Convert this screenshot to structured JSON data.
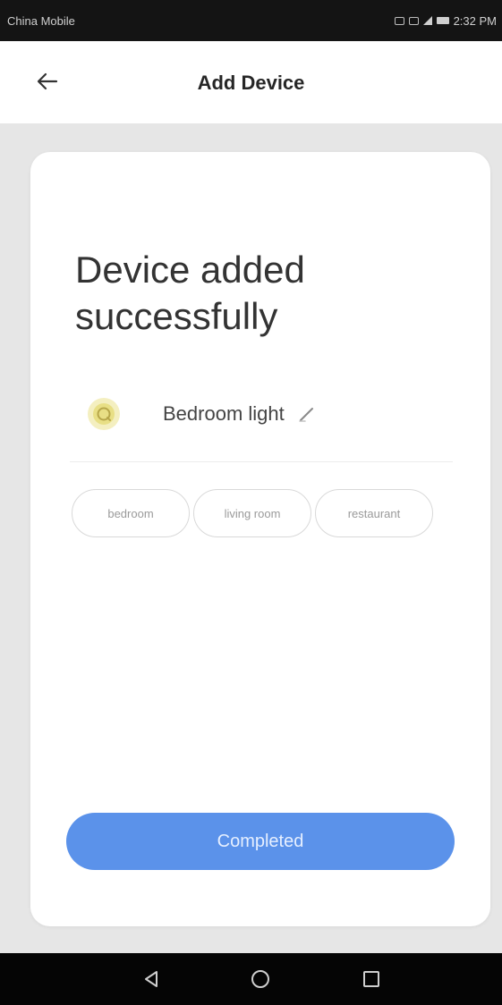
{
  "status_bar": {
    "carrier": "China Mobile",
    "time": "2:32 PM"
  },
  "header": {
    "title": "Add Device",
    "back_icon": "arrow-left-icon"
  },
  "card": {
    "headline": "Device added successfully",
    "device": {
      "icon": "bulb-icon",
      "name": "Bedroom light",
      "edit_icon": "pencil-icon"
    },
    "rooms": [
      "bedroom",
      "living room",
      "restaurant"
    ],
    "completed_label": "Completed"
  },
  "nav_bar": {
    "icons": [
      "triangle-back-icon",
      "circle-home-icon",
      "square-recents-icon"
    ]
  },
  "colors": {
    "accent": "#5b92ea",
    "card_bg": "#ffffff",
    "page_bg": "#e6e6e6",
    "bulb": "#e8df85"
  }
}
